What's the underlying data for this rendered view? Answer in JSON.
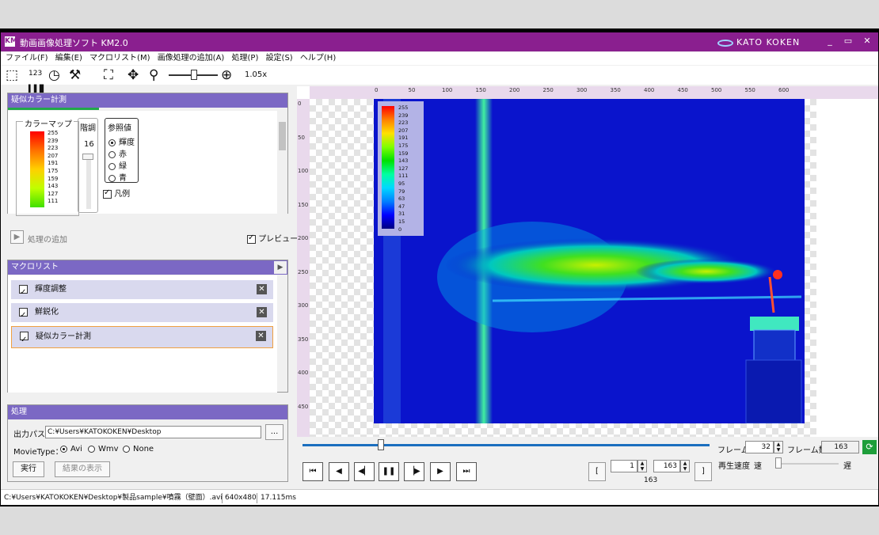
{
  "app": {
    "title": "動画画像処理ソフト KM2.0",
    "brand": "KATO KOKEN",
    "icon_label": "KM"
  },
  "window_controls": {
    "minimize": "_",
    "maximize": "▭",
    "close": "✕"
  },
  "menu": [
    "ファイル(F)",
    "編集(E)",
    "マクロリスト(M)",
    "画像処理の追加(A)",
    "処理(P)",
    "設定(S)",
    "ヘルプ(H)"
  ],
  "toolbar": {
    "zoom": "1.05x",
    "counter_label": "123"
  },
  "color_panel": {
    "title": "疑似カラー計測",
    "colormap_label": "カラーマップ",
    "colormap_values": [
      "255",
      "239",
      "223",
      "207",
      "191",
      "175",
      "159",
      "143",
      "127",
      "111"
    ],
    "levels_label": "階調",
    "levels_value": "16",
    "ref_label": "参照値",
    "ref_options": [
      "輝度",
      "赤",
      "緑",
      "青"
    ],
    "ref_selected": "輝度",
    "legend_label": "凡例"
  },
  "add_process": {
    "label": "処理の追加",
    "preview_label": "プレビュー"
  },
  "macro_panel": {
    "title": "マクロリスト",
    "items": [
      {
        "name": "輝度調整",
        "checked": true
      },
      {
        "name": "鮮鋭化",
        "checked": true
      },
      {
        "name": "疑似カラー計測",
        "checked": true
      }
    ]
  },
  "process_panel": {
    "title": "処理",
    "output_label": "出力パス",
    "output_path": "C:¥Users¥KATOKOKEN¥Desktop",
    "browse_label": "...",
    "movietype_label": "MovieType：",
    "movietypes": [
      "Avi",
      "Wmv",
      "None"
    ],
    "movietype_selected": "Avi",
    "run_label": "実行",
    "show_result_label": "結果の表示"
  },
  "rulers": {
    "top": [
      "0",
      "50",
      "100",
      "150",
      "200",
      "250",
      "300",
      "350",
      "400",
      "450",
      "500",
      "550",
      "600"
    ],
    "left": [
      "0",
      "50",
      "100",
      "150",
      "200",
      "250",
      "300",
      "350",
      "400",
      "450"
    ]
  },
  "image_legend": [
    "255",
    "239",
    "223",
    "207",
    "191",
    "175",
    "159",
    "143",
    "127",
    "111",
    "95",
    "79",
    "63",
    "47",
    "31",
    "15",
    "0"
  ],
  "playback": {
    "frame_label": "フレーム",
    "frame_value": "32",
    "frame_count_label": "フレーム数",
    "frame_count": "163",
    "speed_label": "再生速度",
    "speed_fast": "速",
    "speed_slow": "遅",
    "range_start": "1",
    "range_end": "163",
    "range_total": "163",
    "seek_position": 0.19
  },
  "status": {
    "file": "C:¥Users¥KATOKOKEN¥Desktop¥製品sample¥噴霧（壁面）.avi",
    "resolution": "640x480",
    "time": "17.115ms"
  },
  "colors": {
    "titlebar": "#8a1f8f",
    "panel_header": "#7b68c4",
    "image_bg": "#0a14cc",
    "seek": "#1b6fbf"
  }
}
